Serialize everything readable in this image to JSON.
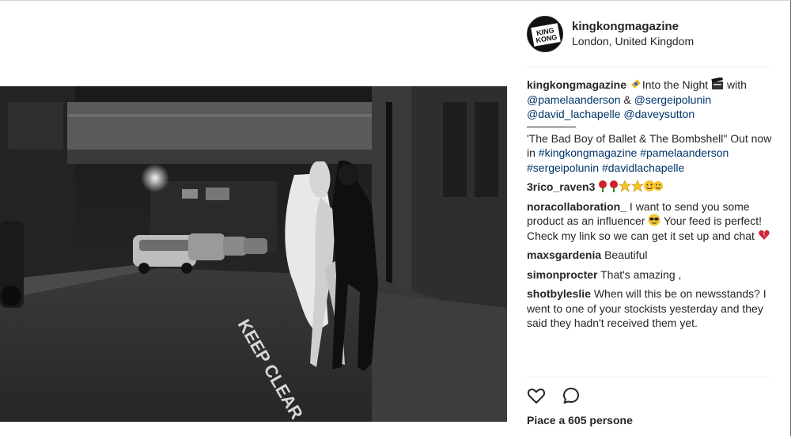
{
  "post": {
    "username": "kingkongmagazine",
    "location": "London, United Kingdom",
    "avatar_text_1": "KING",
    "avatar_text_2": "KONG"
  },
  "caption": {
    "username": "kingkongmagazine",
    "text_1": "Into the Night",
    "text_2": " with",
    "mention_1": "@pamelaanderson",
    "amp": " & ",
    "mention_2": "@sergeipolunin",
    "mention_3": "@david_lachapelle",
    "mention_4": "@daveysutton",
    "text_3": "'The Bad Boy of Ballet & The Bombshell\" Out now in ",
    "tag_1": "#kingkongmagazine",
    "tag_2": "#pamelaanderson",
    "tag_3": "#sergeipolunin",
    "tag_4": "#davidlachapelle"
  },
  "comments": [
    {
      "username": "3rico_raven3",
      "text": ""
    },
    {
      "username": "noracollaboration_",
      "text": "I want to send you some product as an influencer",
      "text_2": " Your feed is perfect! Check my link so we can get it set up and chat "
    },
    {
      "username": "maxsgardenia",
      "text": "Beautiful"
    },
    {
      "username": "simonprocter",
      "text": "That's amazing ,"
    },
    {
      "username": "shotbyleslie",
      "text": "When will this be on newsstands? I went to one of your stockists yesterday and they said they hadn't received them yet."
    }
  ],
  "actions": {
    "like_icon": "heart-outline-icon",
    "comment_icon": "speech-bubble-icon"
  },
  "likes_text": "Piace a 605 persone",
  "colors": {
    "link": "#003569",
    "text": "#262626",
    "divider": "#efefef"
  }
}
